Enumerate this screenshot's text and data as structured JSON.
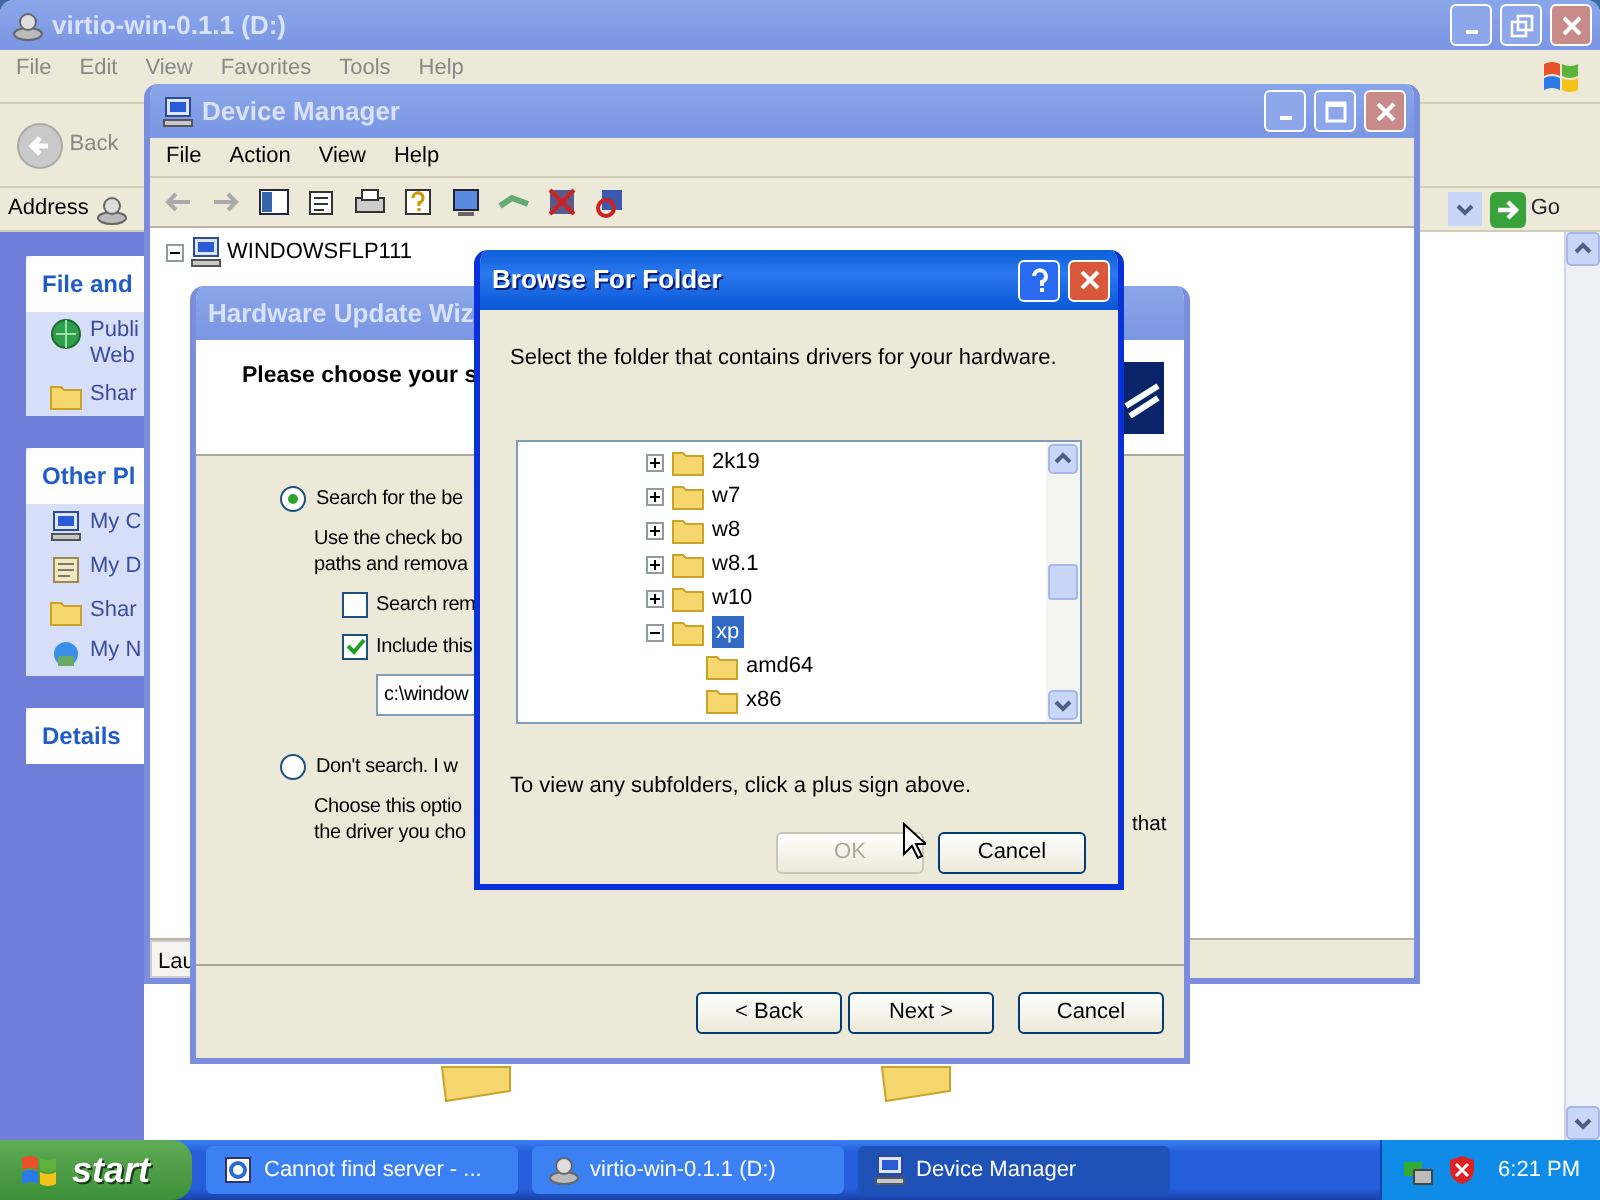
{
  "explorer": {
    "title": "virtio-win-0.1.1 (D:)",
    "menu": [
      "File",
      "Edit",
      "View",
      "Favorites",
      "Tools",
      "Help"
    ],
    "back": "Back",
    "address_label": "Address",
    "go": "Go",
    "panels": [
      {
        "title": "File and",
        "items": [
          "Publi Web",
          "Shar"
        ]
      },
      {
        "title": "Other Pl",
        "items": [
          "My C",
          "My D",
          "Shar",
          "My N"
        ]
      },
      {
        "title": "Details"
      }
    ]
  },
  "device_manager": {
    "title": "Device Manager",
    "menu": [
      "File",
      "Action",
      "View",
      "Help"
    ],
    "tree_root": "WINDOWSFLP111",
    "status": "Lau"
  },
  "wizard": {
    "title": "Hardware Update Wiz",
    "heading": "Please choose your s",
    "options": [
      {
        "label": "Search for the be",
        "selected": true,
        "description": [
          "Use the check bo",
          "paths and remova"
        ]
      },
      {
        "label": "Don't search. I w",
        "selected": false,
        "description": [
          "Choose this optio",
          "the driver you cho"
        ]
      }
    ],
    "checkboxes": [
      {
        "label": "Search rem",
        "checked": false
      },
      {
        "label": "Include this",
        "checked": true
      }
    ],
    "path": "c:\\window",
    "trailing_text": "that",
    "buttons": [
      "< Back",
      "Next >",
      "Cancel"
    ]
  },
  "browse": {
    "title": "Browse For Folder",
    "instruction": "Select the folder that contains drivers for your hardware.",
    "tree": [
      {
        "label": "2k19",
        "expanded": false,
        "selected": false
      },
      {
        "label": "w7",
        "expanded": false,
        "selected": false
      },
      {
        "label": "w8",
        "expanded": false,
        "selected": false
      },
      {
        "label": "w8.1",
        "expanded": false,
        "selected": false
      },
      {
        "label": "w10",
        "expanded": false,
        "selected": false
      },
      {
        "label": "xp",
        "expanded": true,
        "selected": true,
        "children": [
          {
            "label": "amd64",
            "selected": false
          },
          {
            "label": "x86",
            "selected": false
          }
        ]
      }
    ],
    "hint": "To view any subfolders, click a plus sign above.",
    "buttons": [
      {
        "label": "OK",
        "disabled": true
      },
      {
        "label": "Cancel",
        "disabled": false
      }
    ]
  },
  "taskbar": {
    "start": "start",
    "tasks": [
      {
        "label": "Cannot find server - ...",
        "selected": false
      },
      {
        "label": "virtio-win-0.1.1 (D:)",
        "selected": false
      },
      {
        "label": "Device Manager",
        "selected": true
      }
    ],
    "clock": "6:21 PM"
  }
}
